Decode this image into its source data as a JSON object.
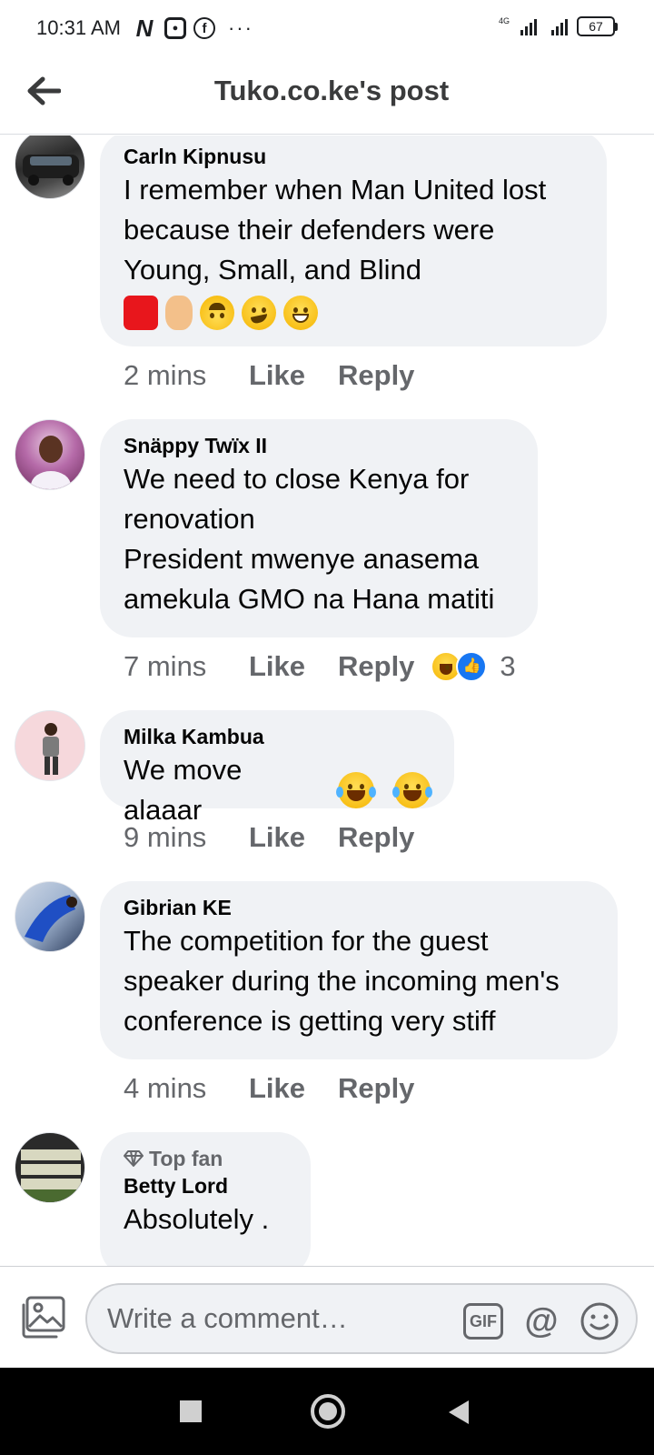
{
  "status_bar": {
    "time": "10:31 AM",
    "network": "4G",
    "battery": "67",
    "icons": [
      "n-app-icon",
      "screen-record-icon",
      "facebook-icon",
      "more-dots-icon",
      "signal-icon",
      "signal-icon",
      "battery-icon"
    ],
    "dots": "···"
  },
  "header": {
    "title": "Tuko.co.ke's post",
    "back_icon": "arrow-left-icon"
  },
  "comments": [
    {
      "author": "Carln Kipnusu",
      "text": "I remember when Man United lost\nbecause their defenders were\nYoung, Small, and Blind",
      "emojis": [
        "red-square",
        "crossed-fingers",
        "upside-down-face",
        "smirking-face",
        "grinning-face"
      ],
      "time": "2 mins",
      "like": "Like",
      "reply": "Reply"
    },
    {
      "author": "Snäppy Twïx II",
      "text": "We need to close Kenya for\nrenovation\nPresident mwenye anasema\namekula GMO na Hana matiti",
      "time": "7 mins",
      "like": "Like",
      "reply": "Reply",
      "reactions": [
        "haha",
        "like"
      ],
      "reaction_count": "3"
    },
    {
      "author": "Milka Kambua",
      "text": "We move alaaar",
      "emojis": [
        "face-with-tears-of-joy",
        "face-with-tears-of-joy"
      ],
      "time": "9 mins",
      "like": "Like",
      "reply": "Reply"
    },
    {
      "author": "Gibrian KE",
      "text": "The competition for the guest\nspeaker during the incoming men's\nconference is getting very stiff",
      "time": "4 mins",
      "like": "Like",
      "reply": "Reply"
    },
    {
      "badge": "Top fan",
      "author": "Betty Lord",
      "text": "Absolutely  ."
    }
  ],
  "composer": {
    "placeholder": "Write a comment…",
    "gif_label": "GIF",
    "mention_label": "@"
  },
  "nav_bar": {
    "buttons": [
      "recent-apps",
      "home",
      "back"
    ]
  }
}
